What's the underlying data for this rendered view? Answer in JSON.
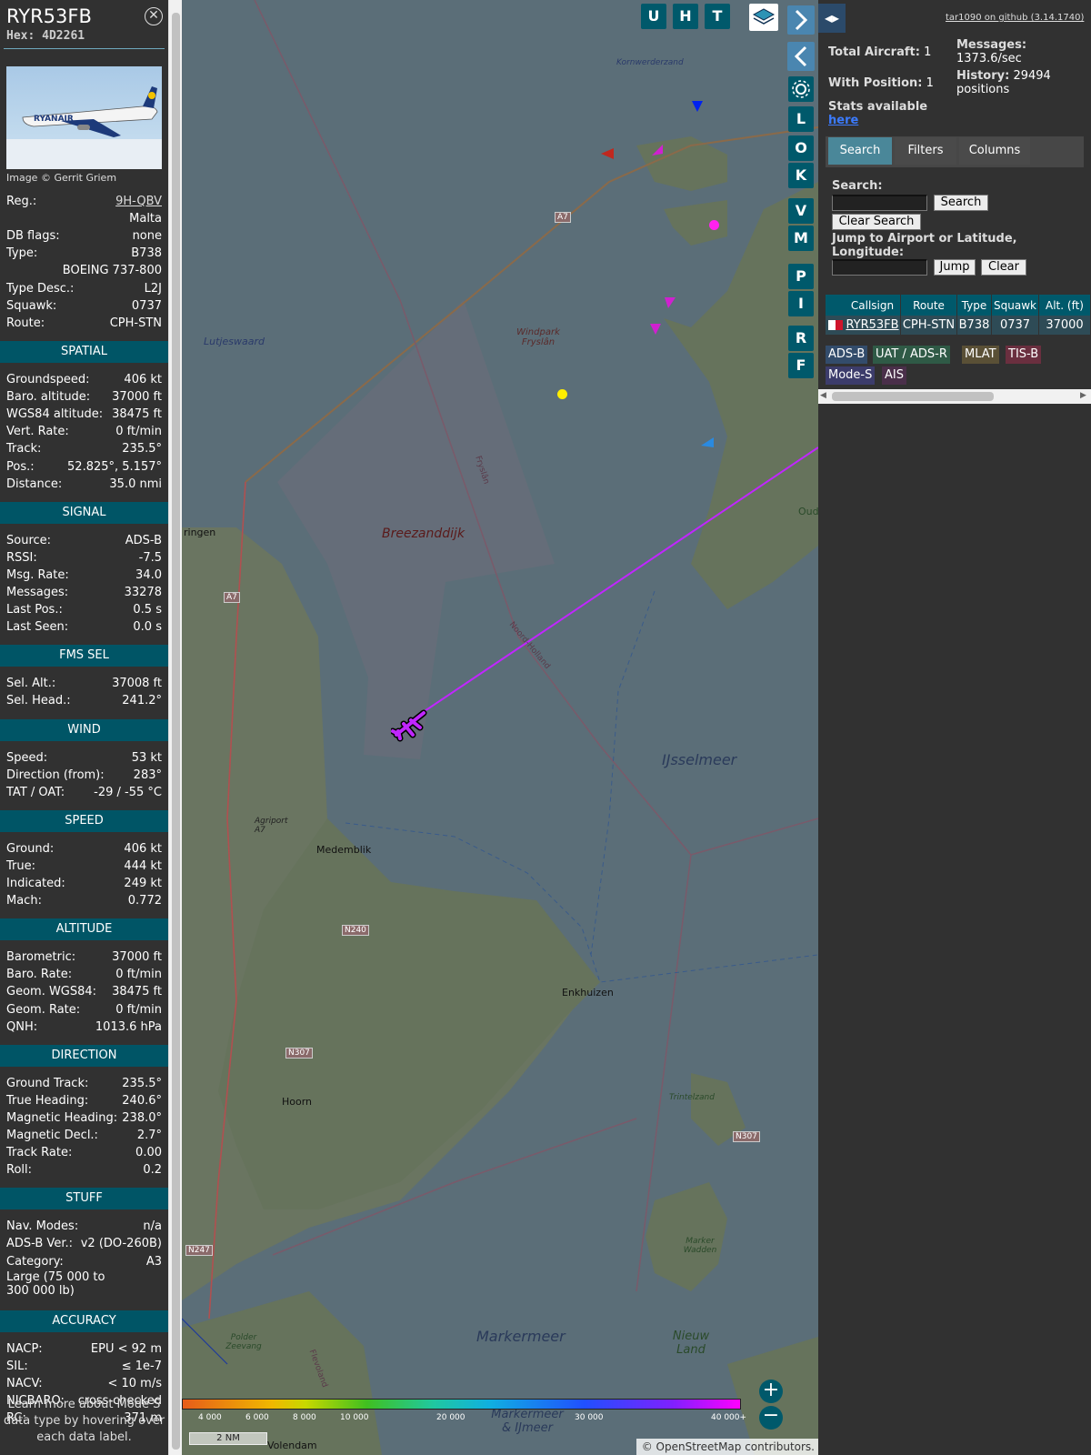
{
  "aircraft": {
    "callsign": "RYR53FB",
    "hex_label": "Hex:",
    "hex": "4D2261",
    "photo_credit": "Image © Gerrit Griem",
    "close_icon": "close-circle-icon",
    "rows": [
      {
        "label": "Reg.:",
        "value": "9H-QBV"
      },
      {
        "label": "",
        "value": "Malta"
      },
      {
        "label": "DB flags:",
        "value": "none"
      },
      {
        "label": "Type:",
        "value": "B738"
      },
      {
        "label": "",
        "value": "BOEING 737-800"
      },
      {
        "label": "Type Desc.:",
        "value": "L2J"
      },
      {
        "label": "Squawk:",
        "value": "0737"
      },
      {
        "label": "Route:",
        "value": "CPH-STN"
      }
    ]
  },
  "sections": [
    {
      "title": "SPATIAL",
      "rows": [
        {
          "label": "Groundspeed:",
          "value": "406 kt"
        },
        {
          "label": "Baro. altitude:",
          "value": "37000 ft"
        },
        {
          "label": "WGS84 altitude:",
          "value": "38475 ft"
        },
        {
          "label": "Vert. Rate:",
          "value": "0 ft/min"
        },
        {
          "label": "Track:",
          "value": "235.5°"
        },
        {
          "label": "Pos.:",
          "value": "52.825°, 5.157°"
        },
        {
          "label": "Distance:",
          "value": "35.0 nmi"
        }
      ]
    },
    {
      "title": "SIGNAL",
      "rows": [
        {
          "label": "Source:",
          "value": "ADS-B"
        },
        {
          "label": "RSSI:",
          "value": "-7.5"
        },
        {
          "label": "Msg. Rate:",
          "value": "34.0"
        },
        {
          "label": "Messages:",
          "value": "33278"
        },
        {
          "label": "Last Pos.:",
          "value": "0.5 s"
        },
        {
          "label": "Last Seen:",
          "value": "0.0 s"
        }
      ]
    },
    {
      "title": "FMS SEL",
      "rows": [
        {
          "label": "Sel. Alt.:",
          "value": "37008 ft"
        },
        {
          "label": "Sel. Head.:",
          "value": "241.2°"
        }
      ]
    },
    {
      "title": "WIND",
      "rows": [
        {
          "label": "Speed:",
          "value": "53 kt"
        },
        {
          "label": "Direction (from):",
          "value": "283°"
        },
        {
          "label": "TAT / OAT:",
          "value": "-29 / -55 °C"
        }
      ]
    },
    {
      "title": "SPEED",
      "rows": [
        {
          "label": "Ground:",
          "value": "406 kt"
        },
        {
          "label": "True:",
          "value": "444 kt"
        },
        {
          "label": "Indicated:",
          "value": "249 kt"
        },
        {
          "label": "Mach:",
          "value": "0.772"
        }
      ]
    },
    {
      "title": "ALTITUDE",
      "rows": [
        {
          "label": "Barometric:",
          "value": "37000 ft"
        },
        {
          "label": "Baro. Rate:",
          "value": "0 ft/min"
        },
        {
          "label": "Geom. WGS84:",
          "value": "38475 ft"
        },
        {
          "label": "Geom. Rate:",
          "value": "0 ft/min"
        },
        {
          "label": "QNH:",
          "value": "1013.6 hPa"
        }
      ]
    },
    {
      "title": "DIRECTION",
      "rows": [
        {
          "label": "Ground Track:",
          "value": "235.5°"
        },
        {
          "label": "True Heading:",
          "value": "240.6°"
        },
        {
          "label": "Magnetic Heading:",
          "value": "238.0°"
        },
        {
          "label": "Magnetic Decl.:",
          "value": "2.7°"
        },
        {
          "label": "Track Rate:",
          "value": "0.00"
        },
        {
          "label": "Roll:",
          "value": "0.2"
        }
      ]
    },
    {
      "title": "STUFF",
      "rows": [
        {
          "label": "Nav. Modes:",
          "value": "n/a"
        },
        {
          "label": "ADS-B Ver.:",
          "value": "v2 (DO-260B)"
        },
        {
          "label": "Category:",
          "value": "A3"
        }
      ],
      "category_desc": "Large (75 000 to 300 000 lb)"
    },
    {
      "title": "ACCURACY",
      "rows": [
        {
          "label": "NACP:",
          "value": "EPU < 92 m"
        },
        {
          "label": "SIL:",
          "value": "≤ 1e-7"
        },
        {
          "label": "NACV:",
          "value": "< 10 m/s"
        },
        {
          "label": "NICBARO:",
          "value": "cross-checked"
        },
        {
          "label": "RC:",
          "value": "371 m"
        }
      ]
    }
  ],
  "learn_more": "Learn more about Mode S data type by hovering over each data label.",
  "map": {
    "layer_buttons": [
      "U",
      "H",
      "T"
    ],
    "right_buttons": [
      "L",
      "O",
      "K",
      "V",
      "M",
      "P",
      "I",
      "R",
      "F"
    ],
    "place_labels": [
      "Kornwerderzand",
      "Lutjeswaard",
      "Windpark Fryslân",
      "Breezanddijk",
      "Medemblik",
      "Enkhuizen",
      "IJsselmeer",
      "Agriport A7",
      "Hoorn",
      "Trintelzand",
      "Markermeer",
      "Nieuw Land",
      "Marker Wadden",
      "Polder Zeevang",
      "Volendam",
      "Markermeer & IJmeer",
      "Fryslân",
      "Noord-Holland",
      "Flevoland",
      "ringen",
      "Oud"
    ],
    "road_labels": [
      "A7",
      "A7",
      "N240",
      "N307",
      "N307",
      "N247"
    ],
    "altitude_scale": [
      "4 000",
      "6 000",
      "8 000",
      "10 000",
      "20 000",
      "30 000",
      "40 000+"
    ],
    "scale_label": "2 NM",
    "attribution": "© OpenStreetMap contributors."
  },
  "panel": {
    "github_link": "tar1090 on github (3.14.1740)",
    "total_aircraft_label": "Total Aircraft:",
    "total_aircraft": "1",
    "with_position_label": "With Position:",
    "with_position": "1",
    "messages_label": "Messages:",
    "messages": "1373.6/sec",
    "history_label": "History:",
    "history": "29494 positions",
    "stats_label": "Stats available",
    "stats_link": "here",
    "tabs": [
      "Search",
      "Filters",
      "Columns"
    ],
    "search_label": "Search:",
    "search_button": "Search",
    "clear_search_button": "Clear Search",
    "jump_label": "Jump to Airport or Latitude, Longitude:",
    "jump_button": "Jump",
    "clear_button": "Clear",
    "table_headers": [
      "Callsign",
      "Route",
      "Type",
      "Squawk",
      "Alt. (ft)"
    ],
    "table_rows": [
      {
        "callsign": "RYR53FB",
        "route": "CPH-STN",
        "type": "B738",
        "squawk": "0737",
        "alt": "37000"
      }
    ],
    "source_legend": [
      {
        "label": "ADS-B",
        "color": "#334c6b"
      },
      {
        "label": "UAT / ADS-R",
        "color": "#2f5a46"
      },
      {
        "label": "MLAT",
        "color": "#5a5036"
      },
      {
        "label": "TIS-B",
        "color": "#6a2f3f"
      },
      {
        "label": "Mode-S",
        "color": "#3c3c6b"
      },
      {
        "label": "AIS",
        "color": "#4a2f4a"
      }
    ]
  },
  "colors": {
    "accent": "#00596b",
    "section": "#005566",
    "track": "#c026ff",
    "panel_bg": "#313131"
  }
}
